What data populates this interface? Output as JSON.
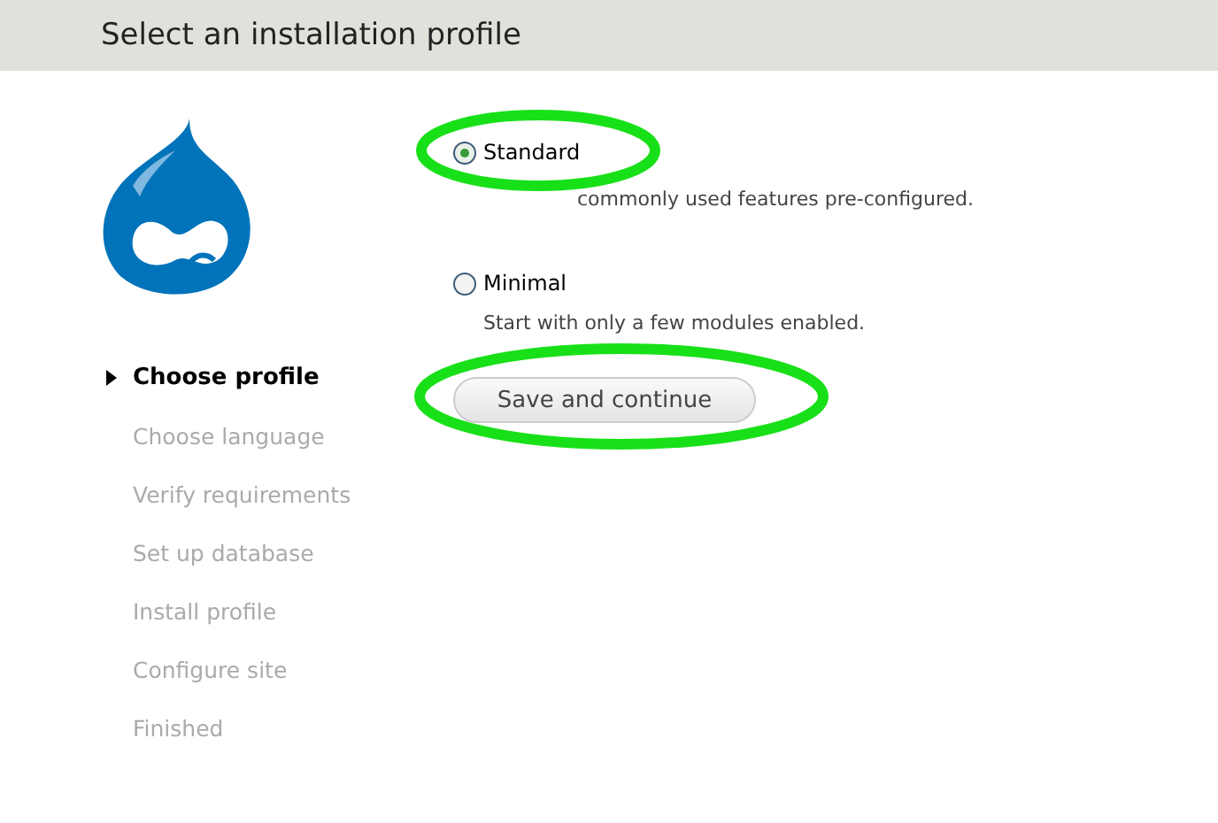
{
  "header": {
    "title": "Select an installation profile"
  },
  "steps": [
    {
      "label": "Choose profile",
      "selected": true
    },
    {
      "label": "Choose language",
      "selected": false
    },
    {
      "label": "Verify requirements",
      "selected": false
    },
    {
      "label": "Set up database",
      "selected": false
    },
    {
      "label": "Install profile",
      "selected": false
    },
    {
      "label": "Configure site",
      "selected": false
    },
    {
      "label": "Finished",
      "selected": false
    }
  ],
  "profiles": [
    {
      "label": "Standard",
      "description": "commonly used features pre-configured.",
      "selected": true,
      "description_covered": true
    },
    {
      "label": "Minimal",
      "description": "Start with only a few modules enabled.",
      "selected": false,
      "description_covered": false
    }
  ],
  "button": {
    "label": "Save and continue"
  }
}
